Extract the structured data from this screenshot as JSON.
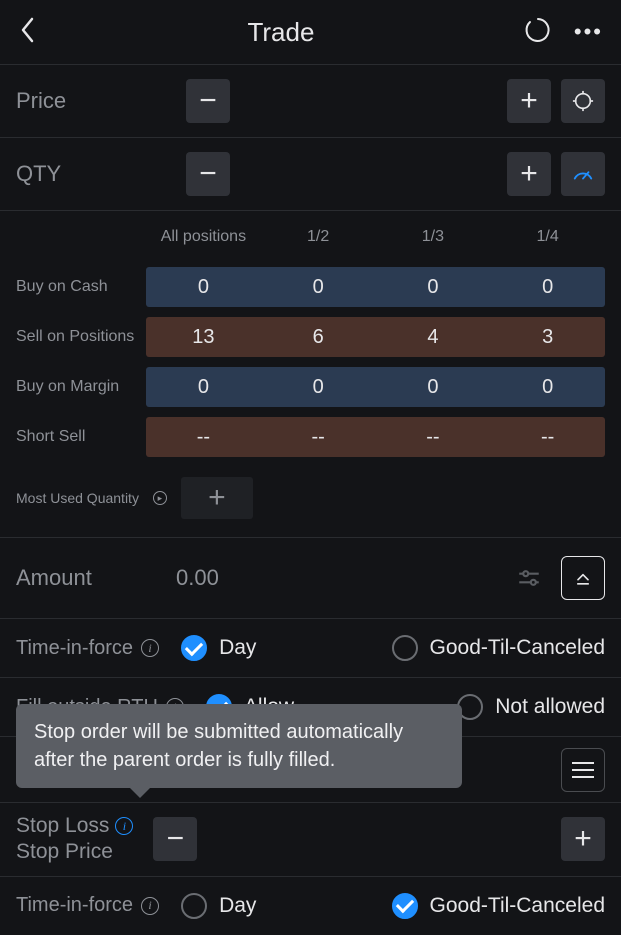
{
  "header": {
    "title": "Trade"
  },
  "price": {
    "label": "Price"
  },
  "qty": {
    "label": "QTY"
  },
  "qtyTable": {
    "headers": [
      "",
      "All positions",
      "1/2",
      "1/3",
      "1/4"
    ],
    "rows": [
      {
        "label": "Buy on Cash",
        "tone": "blue",
        "cells": [
          "0",
          "0",
          "0",
          "0"
        ]
      },
      {
        "label": "Sell on Positions",
        "tone": "brown",
        "cells": [
          "13",
          "6",
          "4",
          "3"
        ]
      },
      {
        "label": "Buy on Margin",
        "tone": "blue",
        "cells": [
          "0",
          "0",
          "0",
          "0"
        ]
      },
      {
        "label": "Short Sell",
        "tone": "brown",
        "cells": [
          "--",
          "--",
          "--",
          "--"
        ]
      }
    ],
    "mostUsedLabel": "Most Used Quantity"
  },
  "amount": {
    "label": "Amount",
    "value": "0.00"
  },
  "tif1": {
    "label": "Time-in-force",
    "opt1": "Day",
    "opt2": "Good-Til-Canceled",
    "selected": "Day"
  },
  "fillRTH": {
    "label": "Fill outside RTH",
    "opt1": "Allow",
    "opt2": "Not allowed",
    "selected": "Allow"
  },
  "tooltip": "Stop order will be submitted automatically after the parent order is fully filled.",
  "stopLoss": {
    "line1": "Stop Loss",
    "line2": "Stop Price"
  },
  "tif2": {
    "label": "Time-in-force",
    "opt1": "Day",
    "opt2": "Good-Til-Canceled",
    "selected": "Good-Til-Canceled"
  }
}
